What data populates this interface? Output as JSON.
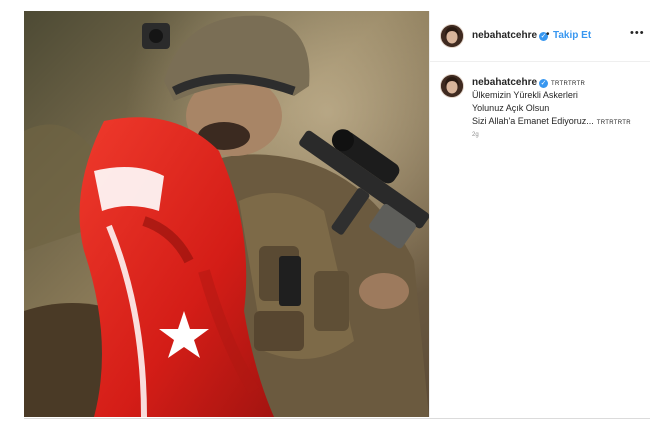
{
  "post": {
    "username": "nebahatcehre",
    "verified_symbol": "✓",
    "separator": "•",
    "follow_label": "Takip Et",
    "more_symbol": "•••",
    "caption": {
      "username": "nebahatcehre",
      "tag_after_name": "TRTRTRTR",
      "lines": [
        "Ülkemizin Yürekli Askerleri",
        "Yolunuz Açık Olsun",
        "Sizi Allah'a Emanet Ediyoruz..."
      ],
      "tag_after_last_line": "TRTRTRTR",
      "time": "2g"
    },
    "image_icon": "soldier-with-turkish-flag-photo",
    "colors": {
      "link_blue": "#3897f0",
      "flag_red": "#e0201b",
      "text": "#262626",
      "muted": "#8e8e8e"
    }
  }
}
